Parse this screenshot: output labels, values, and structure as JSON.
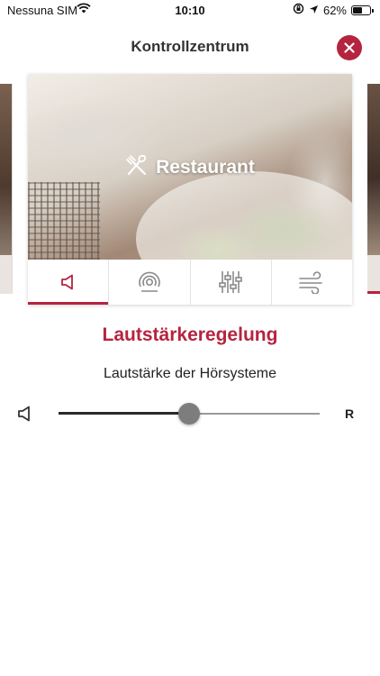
{
  "status_bar": {
    "carrier": "Nessuna SIM",
    "time": "10:10",
    "battery": "62%",
    "battery_level": 0.62
  },
  "header": {
    "title": "Kontrollzentrum"
  },
  "card": {
    "program_name": "Restaurant",
    "tabs": [
      {
        "icon": "speaker-icon",
        "active": true
      },
      {
        "icon": "surround-icon",
        "active": false
      },
      {
        "icon": "equalizer-icon",
        "active": false
      },
      {
        "icon": "wind-icon",
        "active": false
      }
    ]
  },
  "volume": {
    "title": "Lautstärkeregelung",
    "subtitle": "Lautstärke der Hörsysteme",
    "side_label": "R",
    "level": 0.5
  },
  "colors": {
    "accent": "#b5243f",
    "thumb": "#7d7d7d"
  }
}
